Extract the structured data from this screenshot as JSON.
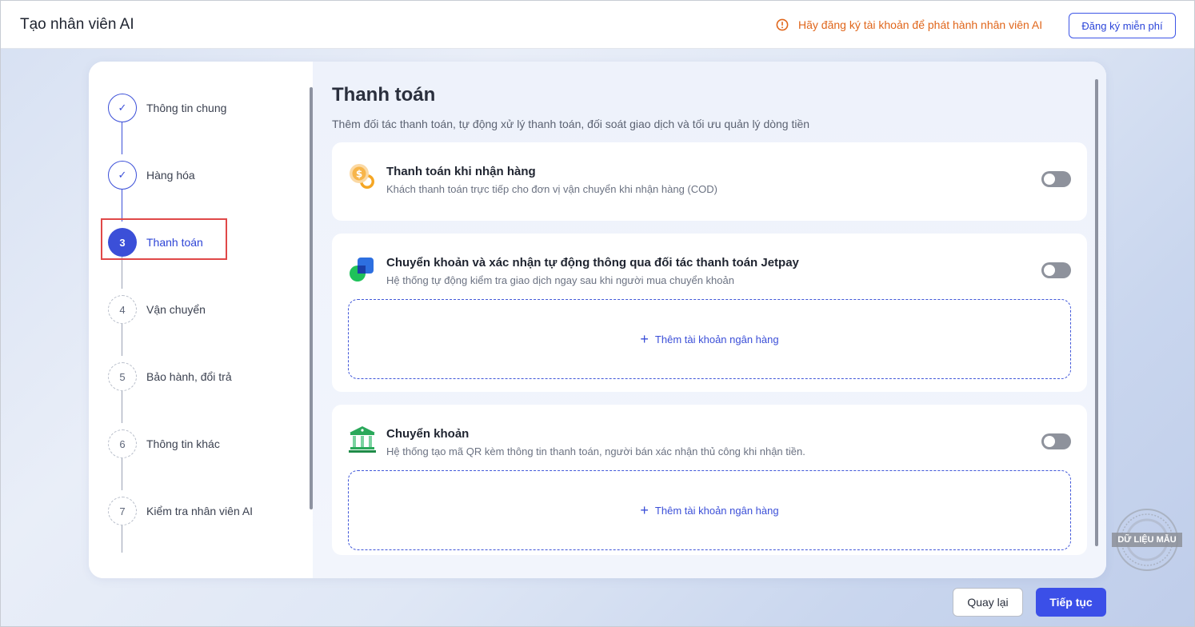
{
  "header": {
    "title": "Tạo nhân viên AI",
    "warning_text": "Hãy đăng ký tài khoản để phát hành nhân viên AI",
    "register_label": "Đăng ký miễn phí",
    "warning_color": "#e0661b"
  },
  "steps": [
    {
      "marker": "✓",
      "label": "Thông tin chung",
      "status": "done"
    },
    {
      "marker": "✓",
      "label": "Hàng hóa",
      "status": "done"
    },
    {
      "marker": "3",
      "label": "Thanh toán",
      "status": "active"
    },
    {
      "marker": "4",
      "label": "Vận chuyển",
      "status": "pending"
    },
    {
      "marker": "5",
      "label": "Bảo hành, đổi trả",
      "status": "pending"
    },
    {
      "marker": "6",
      "label": "Thông tin khác",
      "status": "pending"
    },
    {
      "marker": "7",
      "label": "Kiểm tra nhân viên AI",
      "status": "pending"
    }
  ],
  "content": {
    "title": "Thanh toán",
    "subtitle": "Thêm đối tác thanh toán, tự động xử lý thanh toán, đối soát giao dịch và tối ưu quản lý dòng tiền",
    "methods": [
      {
        "icon": "coin-icon",
        "title": "Thanh toán khi nhận hàng",
        "desc": "Khách thanh toán trực tiếp cho đơn vị vận chuyển khi nhận hàng (COD)",
        "enabled": false
      },
      {
        "icon": "jetpay-icon",
        "title": "Chuyển khoản và xác nhận tự động thông qua đối tác thanh toán Jetpay",
        "desc": "Hệ thống tự động kiểm tra giao dịch ngay sau khi người mua chuyển khoản",
        "enabled": false,
        "add_label": "Thêm tài khoản ngân hàng"
      },
      {
        "icon": "bank-icon",
        "title": "Chuyển khoản",
        "desc": "Hệ thống tạo mã QR kèm thông tin thanh toán, người bán xác nhận thủ công khi nhận tiền.",
        "enabled": false,
        "add_label": "Thêm tài khoản ngân hàng"
      }
    ]
  },
  "footer": {
    "back_label": "Quay lại",
    "next_label": "Tiếp tục"
  },
  "watermark": "DỮ LIỆU MẪU",
  "colors": {
    "primary": "#3b4fe8",
    "highlight_box": "#e04848"
  }
}
